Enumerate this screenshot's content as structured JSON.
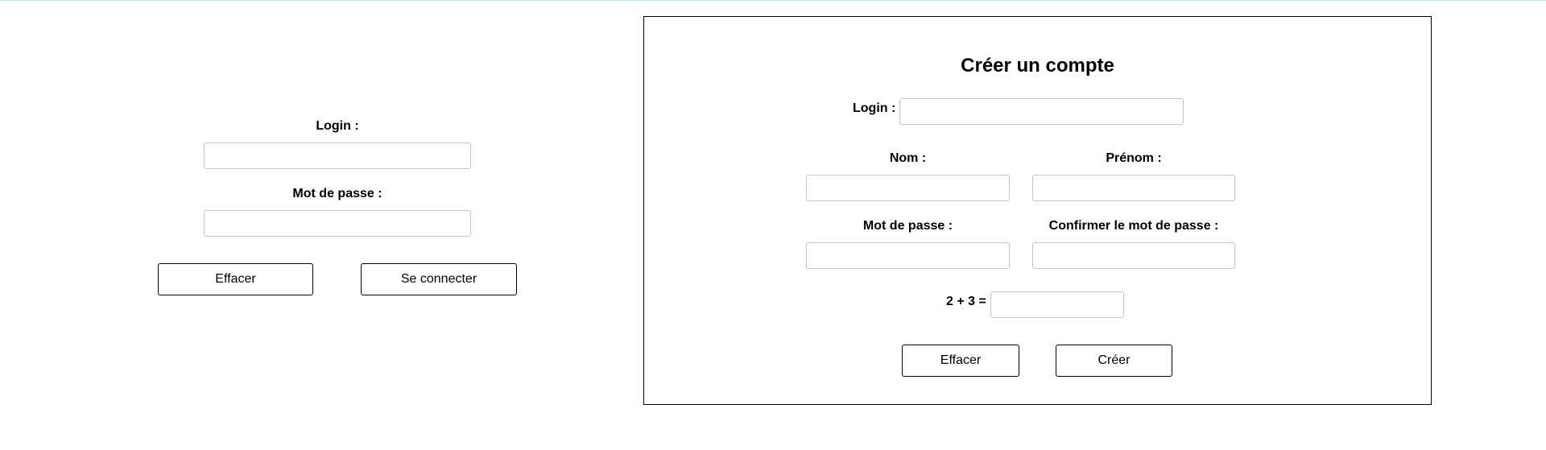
{
  "login_panel": {
    "login_label": "Login :",
    "password_label": "Mot de passe :",
    "clear_button": "Effacer",
    "submit_button": "Se connecter"
  },
  "signup_panel": {
    "title": "Créer un compte",
    "login_label": "Login :",
    "lastname_label": "Nom :",
    "firstname_label": "Prénom :",
    "password_label": "Mot de passe :",
    "confirm_password_label": "Confirmer le mot de passe :",
    "captcha_label": "2 + 3 =",
    "clear_button": "Effacer",
    "create_button": "Créer"
  }
}
